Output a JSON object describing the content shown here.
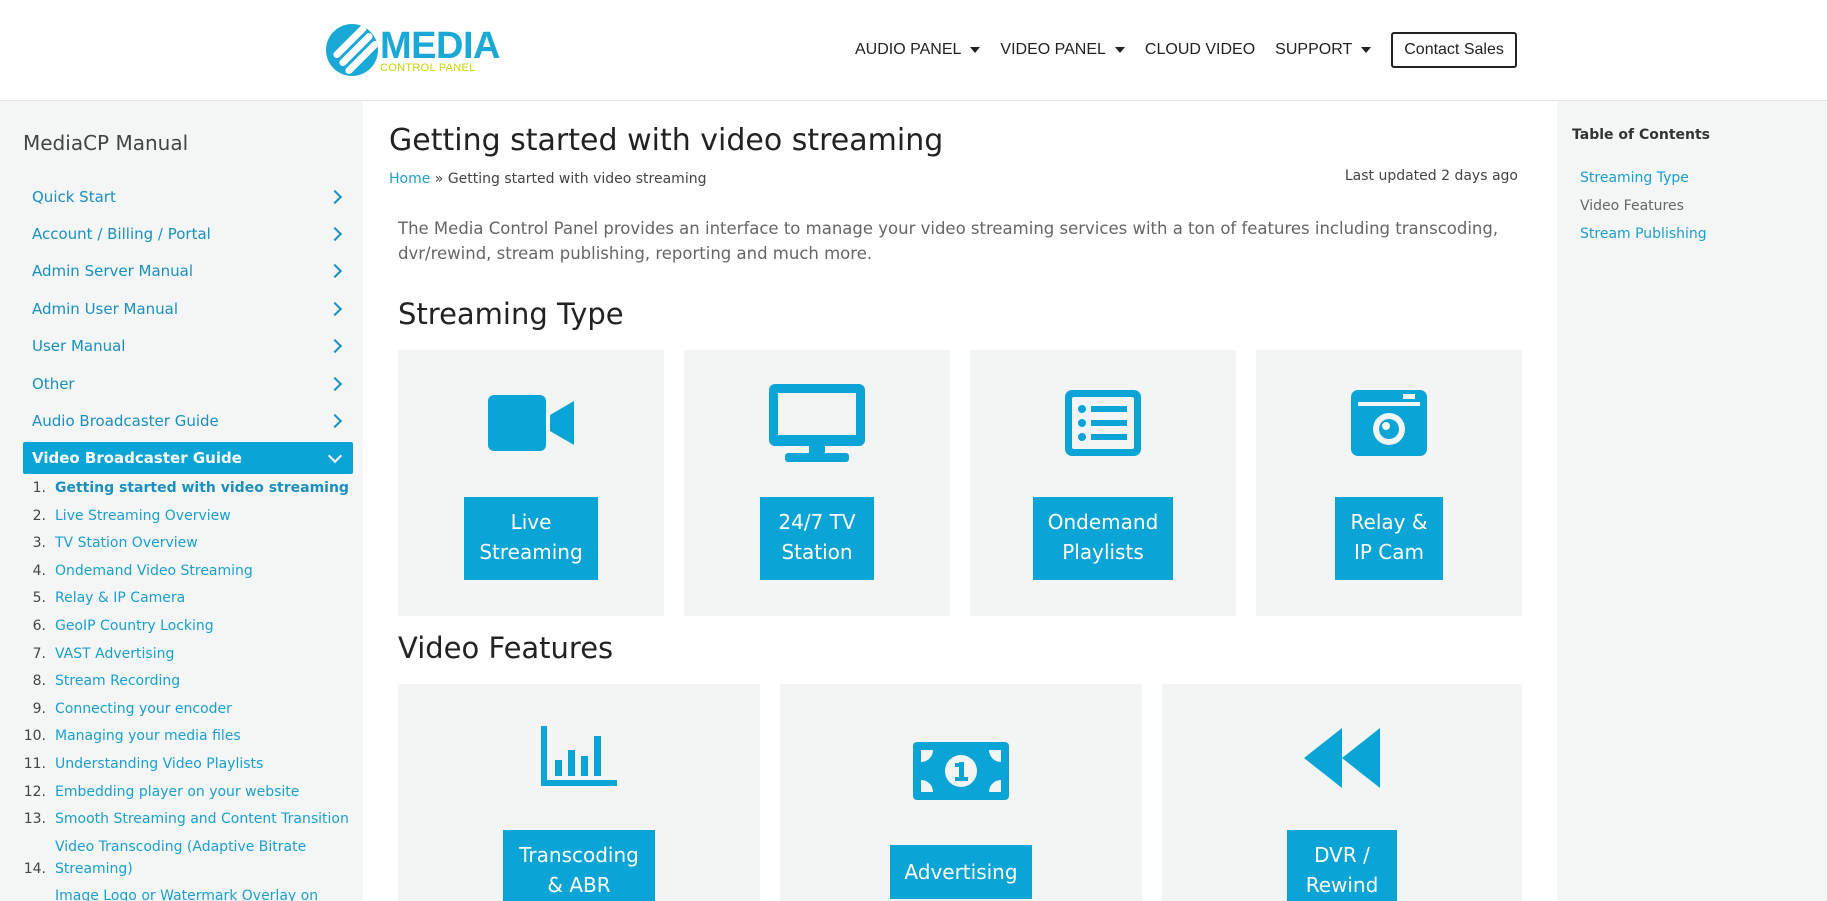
{
  "header": {
    "logo_main": "MEDIA",
    "logo_sub": "CONTROL PANEL",
    "nav": [
      "AUDIO PANEL",
      "VIDEO PANEL",
      "CLOUD VIDEO",
      "SUPPORT"
    ],
    "contact": "Contact Sales"
  },
  "sidebar": {
    "title": "MediaCP Manual",
    "items": [
      {
        "label": "Quick Start"
      },
      {
        "label": "Account / Billing / Portal"
      },
      {
        "label": "Admin Server Manual"
      },
      {
        "label": "Admin User Manual"
      },
      {
        "label": "User Manual"
      },
      {
        "label": "Other"
      },
      {
        "label": "Audio Broadcaster Guide"
      },
      {
        "label": "Video Broadcaster Guide"
      }
    ],
    "sub_items": [
      {
        "num": "1.",
        "label": "Getting started with video streaming"
      },
      {
        "num": "2.",
        "label": "Live Streaming Overview"
      },
      {
        "num": "3.",
        "label": "TV Station Overview"
      },
      {
        "num": "4.",
        "label": "Ondemand Video Streaming"
      },
      {
        "num": "5.",
        "label": "Relay & IP Camera"
      },
      {
        "num": "6.",
        "label": "GeoIP Country Locking"
      },
      {
        "num": "7.",
        "label": "VAST Advertising"
      },
      {
        "num": "8.",
        "label": "Stream Recording"
      },
      {
        "num": "9.",
        "label": "Connecting your encoder"
      },
      {
        "num": "10.",
        "label": "Managing your media files"
      },
      {
        "num": "11.",
        "label": "Understanding Video Playlists"
      },
      {
        "num": "12.",
        "label": "Embedding player on your website"
      },
      {
        "num": "13.",
        "label": "Smooth Streaming and Content Transition"
      },
      {
        "num": "14.",
        "label": "Video Transcoding (Adaptive Bitrate Streaming)"
      },
      {
        "num": "",
        "label": "Image Logo or Watermark Overlay on Video"
      }
    ]
  },
  "main": {
    "title": "Getting started with video streaming",
    "breadcrumb_home": "Home",
    "breadcrumb_sep": " » ",
    "breadcrumb_current": "Getting started with video streaming",
    "last_updated": "Last updated 2 days ago",
    "intro": "The Media Control Panel provides an interface to manage your video streaming services with a ton of features including transcoding, dvr/rewind, stream publishing, reporting and much more.",
    "streaming_type_heading": "Streaming Type",
    "streaming_types": [
      {
        "label_1": "Live",
        "label_2": "Streaming",
        "icon": "video-camera-icon"
      },
      {
        "label_1": "24/7 TV",
        "label_2": "Station",
        "icon": "tv-icon"
      },
      {
        "label_1": "Ondemand",
        "label_2": "Playlists",
        "icon": "list-icon"
      },
      {
        "label_1": "Relay &",
        "label_2": "IP Cam",
        "icon": "camera-icon"
      }
    ],
    "video_features_heading": "Video Features",
    "video_features": [
      {
        "label_1": "Transcoding",
        "label_2": "& ABR",
        "icon": "bar-chart-icon"
      },
      {
        "label_1": "Advertising",
        "label_2": "",
        "icon": "money-icon"
      },
      {
        "label_1": "DVR /",
        "label_2": "Rewind",
        "icon": "rewind-icon"
      }
    ]
  },
  "toc": {
    "title": "Table of Contents",
    "items": [
      "Streaming Type",
      "Video Features",
      "Stream Publishing"
    ]
  },
  "colors": {
    "accent": "#0aa5d6",
    "link": "#1a9fd0",
    "panel": "#f4f6f6",
    "logo_sub": "#c7d300"
  }
}
